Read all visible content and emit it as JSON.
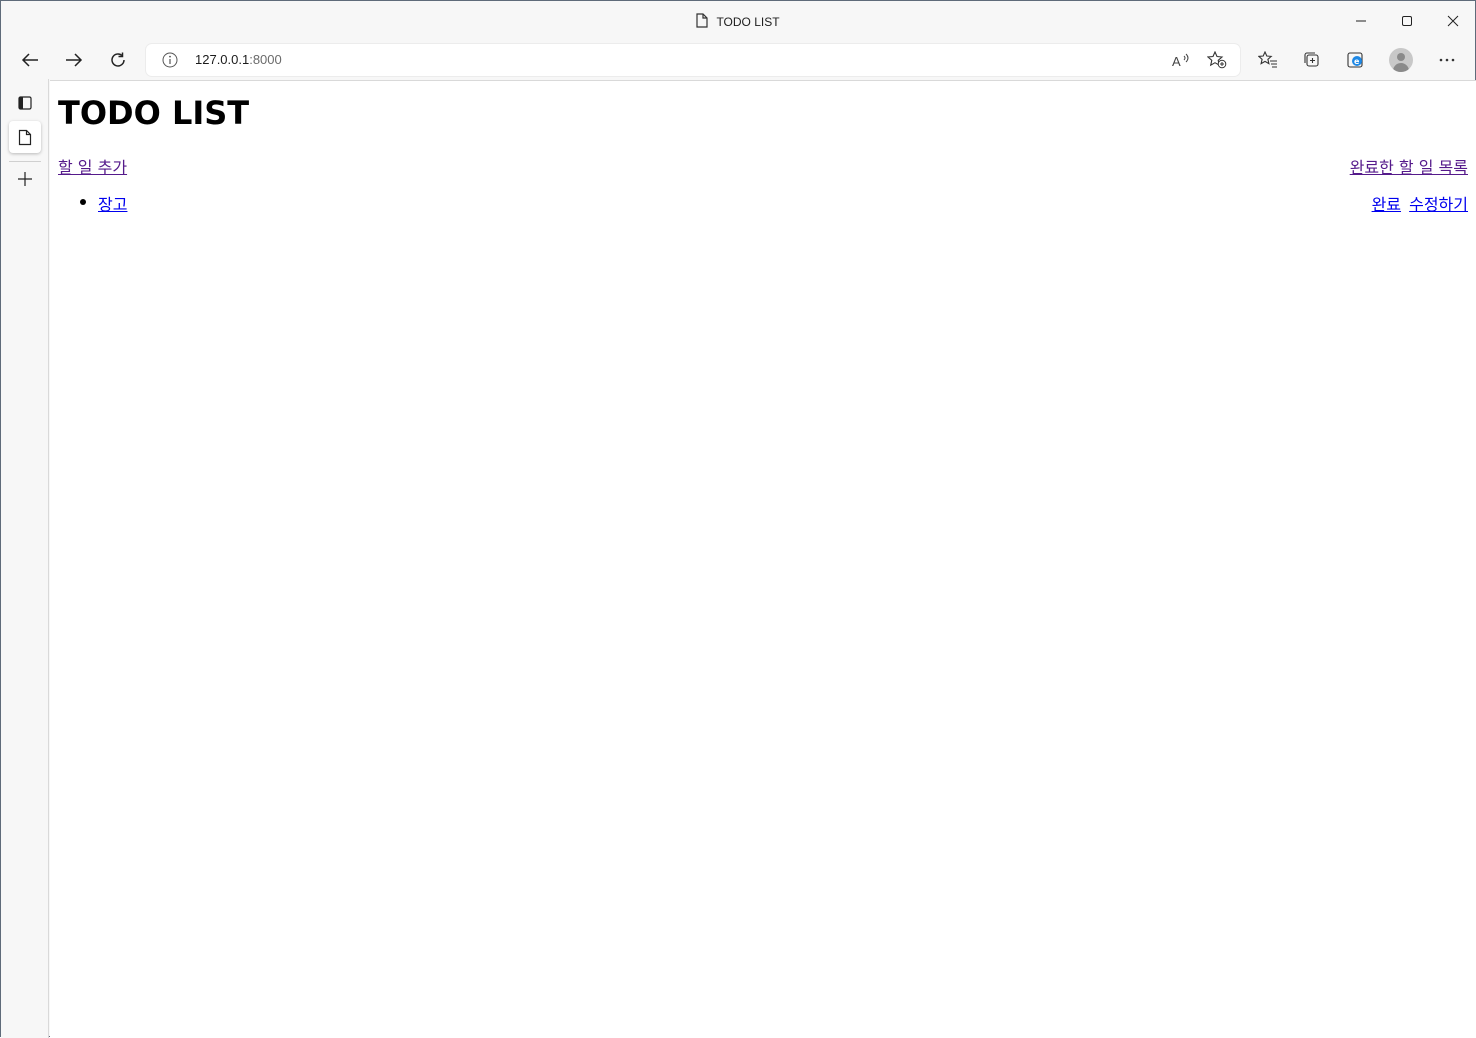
{
  "browser": {
    "tab_title": "TODO LIST",
    "address": {
      "host": "127.0.0.1",
      "port": ":8000"
    }
  },
  "page": {
    "heading": "TODO LIST",
    "add_link": "할 일 추가",
    "completed_list_link": "완료한 할 일 목록",
    "todos": [
      {
        "title": "장고",
        "complete_label": "완료",
        "edit_label": "수정하기"
      }
    ]
  },
  "colors": {
    "link": "#0000ee",
    "visited_link": "#551a8b",
    "chrome_bg": "#f7f7f7"
  }
}
